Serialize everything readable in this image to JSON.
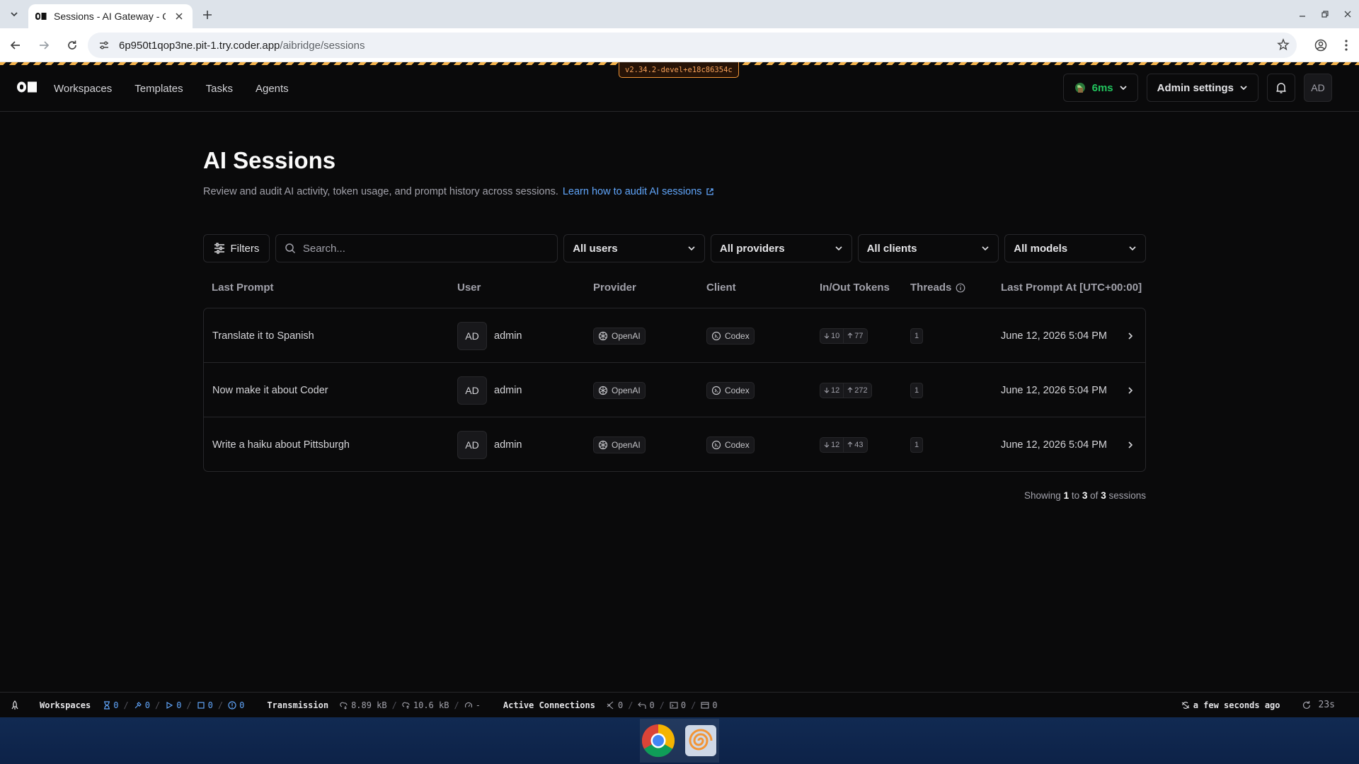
{
  "browser": {
    "tab_title": "Sessions - AI Gateway - C",
    "url_host": "6p950t1qop3ne.pit-1.try.coder.app",
    "url_path": "/aibridge/sessions"
  },
  "app": {
    "version": "v2.34.2-devel+e18c86354c",
    "nav": [
      "Workspaces",
      "Templates",
      "Tasks",
      "Agents"
    ],
    "latency": "6ms",
    "admin_label": "Admin settings",
    "avatar": "AD"
  },
  "page": {
    "title": "AI Sessions",
    "description": "Review and audit AI activity, token usage, and prompt history across sessions.",
    "link": "Learn how to audit AI sessions"
  },
  "filters": {
    "filters_label": "Filters",
    "search_placeholder": "Search...",
    "users": "All users",
    "providers": "All providers",
    "clients": "All clients",
    "models": "All models"
  },
  "table": {
    "headers": {
      "last_prompt": "Last Prompt",
      "user": "User",
      "provider": "Provider",
      "client": "Client",
      "tokens": "In/Out Tokens",
      "threads": "Threads",
      "last_prompt_at": "Last Prompt At [UTC+00:00]"
    },
    "rows": [
      {
        "prompt": "Translate it to Spanish",
        "avatar": "AD",
        "user": "admin",
        "provider": "OpenAI",
        "client": "Codex",
        "in": "10",
        "out": "77",
        "threads": "1",
        "time": "June 12, 2026 5:04 PM"
      },
      {
        "prompt": "Now make it about Coder",
        "avatar": "AD",
        "user": "admin",
        "provider": "OpenAI",
        "client": "Codex",
        "in": "12",
        "out": "272",
        "threads": "1",
        "time": "June 12, 2026 5:04 PM"
      },
      {
        "prompt": "Write a haiku about Pittsburgh",
        "avatar": "AD",
        "user": "admin",
        "provider": "OpenAI",
        "client": "Codex",
        "in": "12",
        "out": "43",
        "threads": "1",
        "time": "June 12, 2026 5:04 PM"
      }
    ]
  },
  "pagination": {
    "prefix": "Showing",
    "from": "1",
    "to_word": "to",
    "to": "3",
    "of_word": "of",
    "total": "3",
    "suffix": "sessions"
  },
  "statusbar": {
    "workspaces_label": "Workspaces",
    "ws_pending": "0",
    "ws_building": "0",
    "ws_running": "0",
    "ws_stopped": "0",
    "ws_failed": "0",
    "transmission_label": "Transmission",
    "tx_sent": "8.89 kB",
    "tx_received": "10.6 kB",
    "tx_latency": "-",
    "connections_label": "Active Connections",
    "conn_vscode": "0",
    "conn_ssh": "0",
    "conn_pty": "0",
    "conn_apps": "0",
    "updated": "a few seconds ago",
    "refresh": "23s"
  }
}
